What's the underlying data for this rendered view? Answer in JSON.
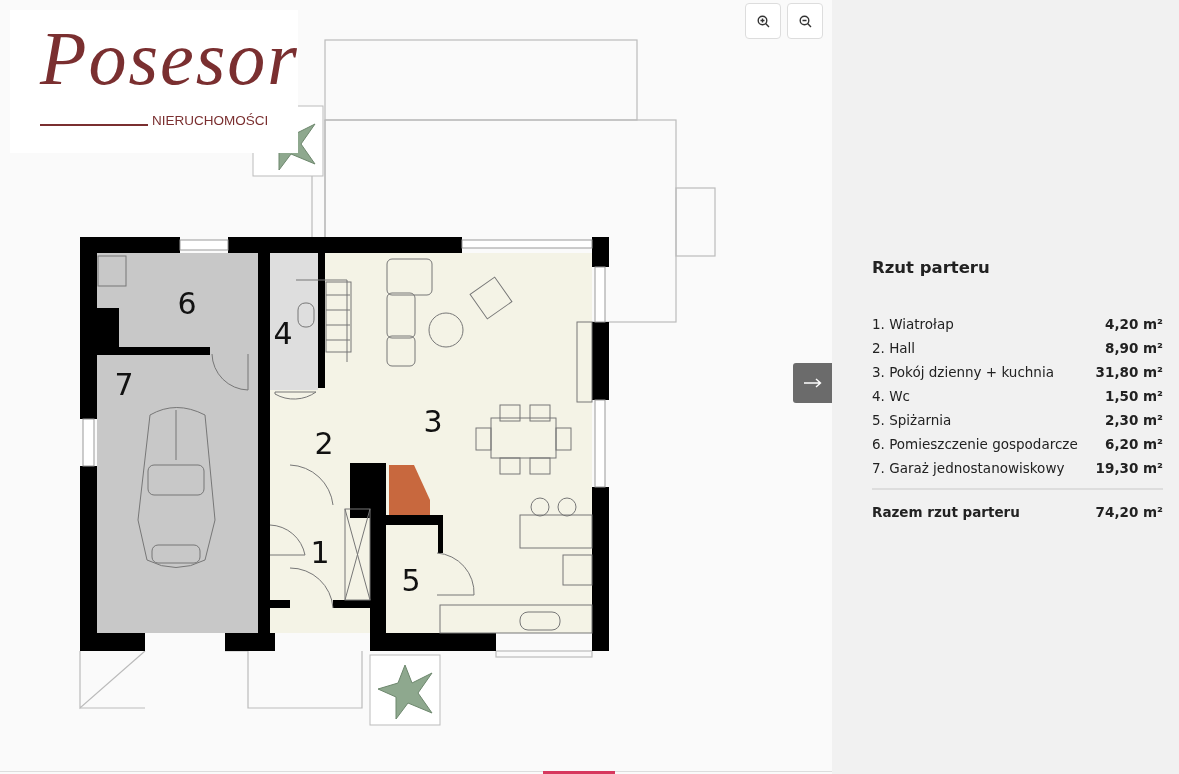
{
  "logo": {
    "wordmark": "Posesor",
    "tagline": "NIERUCHOMOŚCI"
  },
  "zoom_controls": [
    {
      "kind": "zoom-in"
    },
    {
      "kind": "zoom-out"
    }
  ],
  "plan": {
    "room_numbers": [
      "6",
      "7",
      "4",
      "2",
      "3",
      "1",
      "5"
    ]
  },
  "panel": {
    "title": "Rzut parteru",
    "rooms": [
      {
        "name": "1. Wiatrołap",
        "area": "4,20 m²"
      },
      {
        "name": "2. Hall",
        "area": "8,90 m²"
      },
      {
        "name": "3. Pokój dzienny + kuchnia",
        "area": "31,80 m²"
      },
      {
        "name": "4. Wc",
        "area": "1,50 m²"
      },
      {
        "name": "5. Spiżarnia",
        "area": "2,30 m²"
      },
      {
        "name": "6. Pomieszczenie gospodarcze",
        "area": "6,20 m²"
      },
      {
        "name": "7. Garaż jednostanowiskowy",
        "area": "19,30 m²"
      }
    ],
    "total": {
      "label": "Razem rzut parteru",
      "area": "74,20 m²"
    }
  }
}
